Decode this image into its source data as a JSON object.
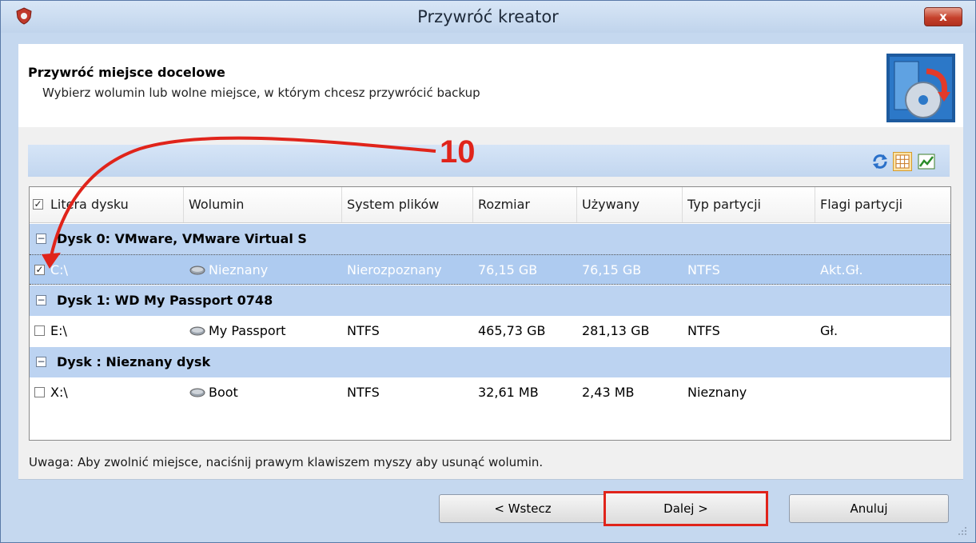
{
  "window": {
    "title": "Przywróć kreator",
    "close_label": "x"
  },
  "header": {
    "title": "Przywróć miejsce docelowe",
    "subtitle": "Wybierz wolumin lub wolne miejsce, w którym chcesz przywrócić backup"
  },
  "toolbar": {
    "icons": [
      "refresh-icon",
      "grid-view-icon",
      "chart-view-icon"
    ]
  },
  "table": {
    "columns": [
      "Litera dysku",
      "Wolumin",
      "System plików",
      "Rozmiar",
      "Używany",
      "Typ partycji",
      "Flagi partycji"
    ],
    "groups": [
      {
        "label": "Dysk 0: VMware, VMware Virtual S",
        "rows": [
          {
            "checked": true,
            "letter": "C:\\",
            "volume": "Nieznany",
            "fs": "Nierozpoznany",
            "size": "76,15 GB",
            "used": "76,15 GB",
            "type": "NTFS",
            "flags": "Akt.Gł."
          }
        ]
      },
      {
        "label": "Dysk 1: WD My Passport 0748",
        "rows": [
          {
            "checked": false,
            "letter": "E:\\",
            "volume": "My Passport",
            "fs": "NTFS",
            "size": "465,73 GB",
            "used": "281,13 GB",
            "type": "NTFS",
            "flags": "Gł."
          }
        ]
      },
      {
        "label": "Dysk : Nieznany dysk",
        "rows": [
          {
            "checked": false,
            "letter": "X:\\",
            "volume": "Boot",
            "fs": "NTFS",
            "size": "32,61 MB",
            "used": "2,43 MB",
            "type": "Nieznany",
            "flags": ""
          }
        ]
      }
    ]
  },
  "note": "Uwaga: Aby zwolnić miejsce, naciśnij prawym klawiszem myszy aby usunąć wolumin.",
  "buttons": {
    "back": "< Wstecz",
    "next": "Dalej >",
    "cancel": "Anuluj"
  },
  "annotation": {
    "number": "10",
    "color": "#e0241b"
  }
}
